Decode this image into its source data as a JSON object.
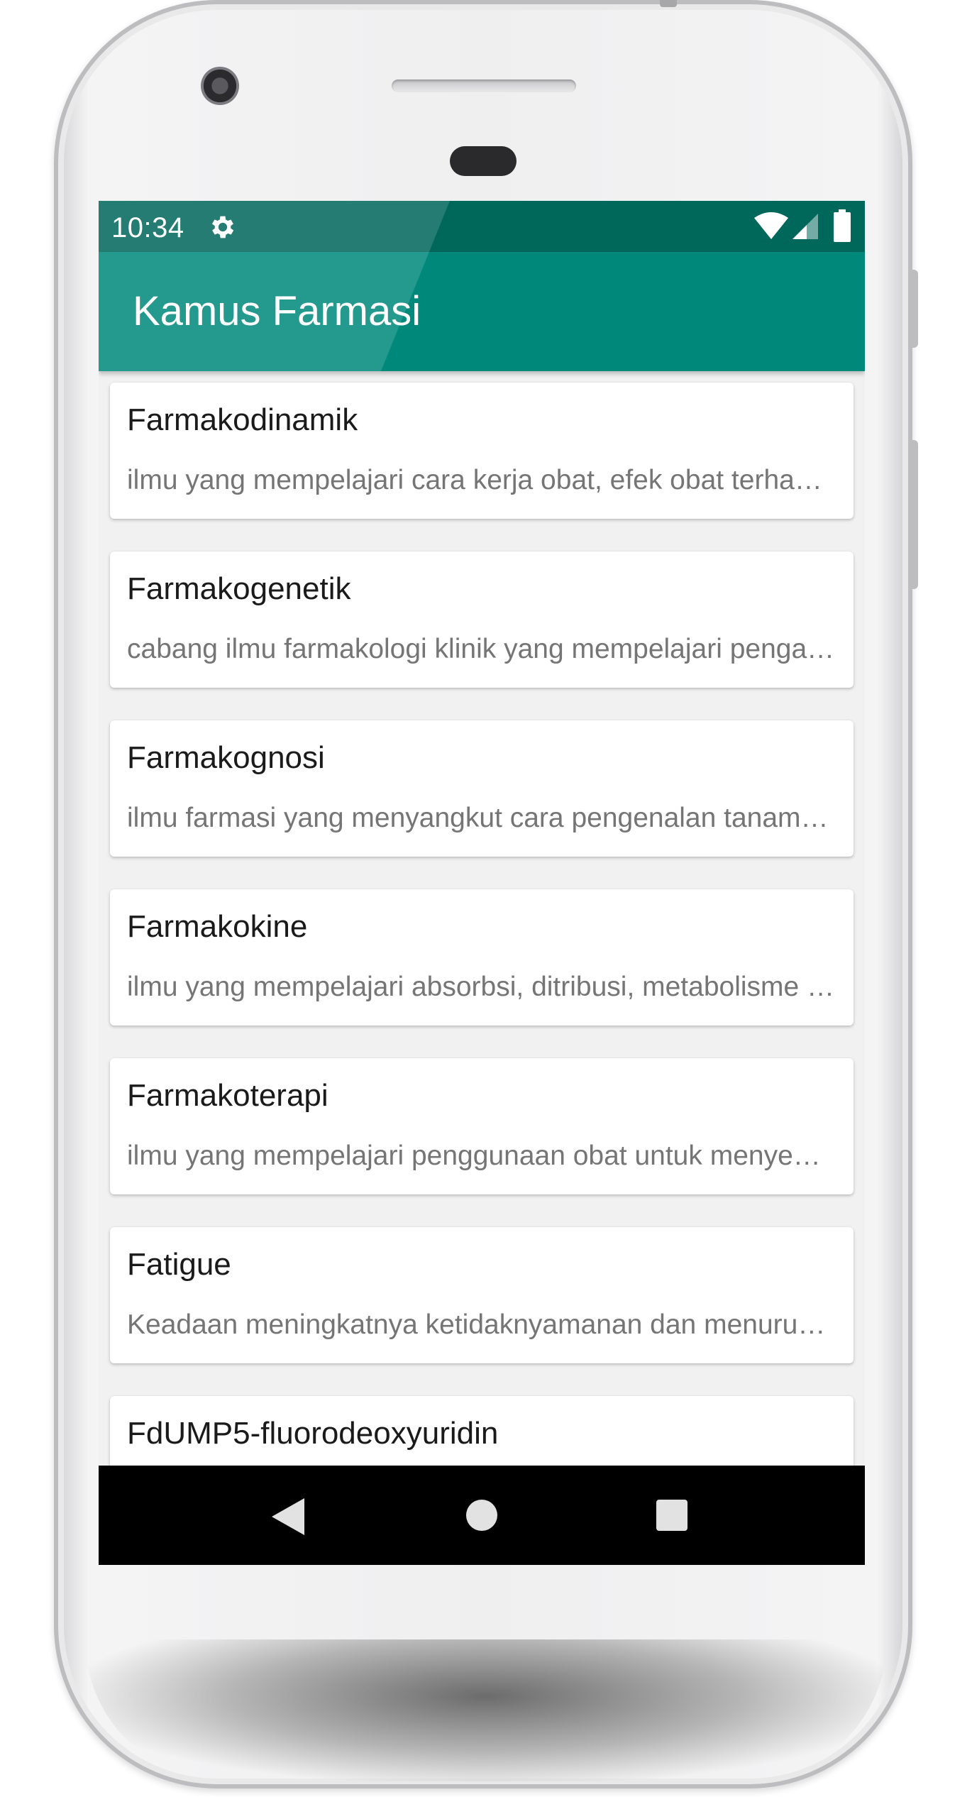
{
  "status_bar": {
    "time": "10:34",
    "icons": [
      "gear-icon",
      "wifi-icon",
      "cell-signal-icon",
      "battery-icon"
    ]
  },
  "app_bar": {
    "title": "Kamus Farmasi"
  },
  "colors": {
    "primary": "#00897b",
    "primary_dark": "#00675b",
    "background": "#f1f1f1",
    "card": "#ffffff",
    "title_text": "#1a1a1a",
    "desc_text": "#757575"
  },
  "terms": [
    {
      "title": "Farmakodinamik",
      "description": "ilmu yang mempelajari cara kerja obat, efek obat terhadap tubuh"
    },
    {
      "title": "Farmakogenetik",
      "description": "cabang ilmu farmakologi klinik yang mempelajari pengaruh genetik"
    },
    {
      "title": "Farmakognosi",
      "description": "ilmu farmasi yang menyangkut cara pengenalan tanaman obat"
    },
    {
      "title": "Farmakokine",
      "description": "ilmu yang mempelajari absorbsi, ditribusi, metabolisme dan ekskresi obat"
    },
    {
      "title": "Farmakoterapi",
      "description": "ilmu yang mempelajari penggunaan obat untuk menyembuhkan penyakit"
    },
    {
      "title": "Fatigue",
      "description": "Keadaan meningkatnya ketidaknyamanan dan menurunnya efisiensi"
    },
    {
      "title": "FdUMP5-fluorodeoxyuridin",
      "description": ""
    }
  ],
  "nav_bar": {
    "icons": [
      "back-icon",
      "home-icon",
      "recents-icon"
    ]
  }
}
